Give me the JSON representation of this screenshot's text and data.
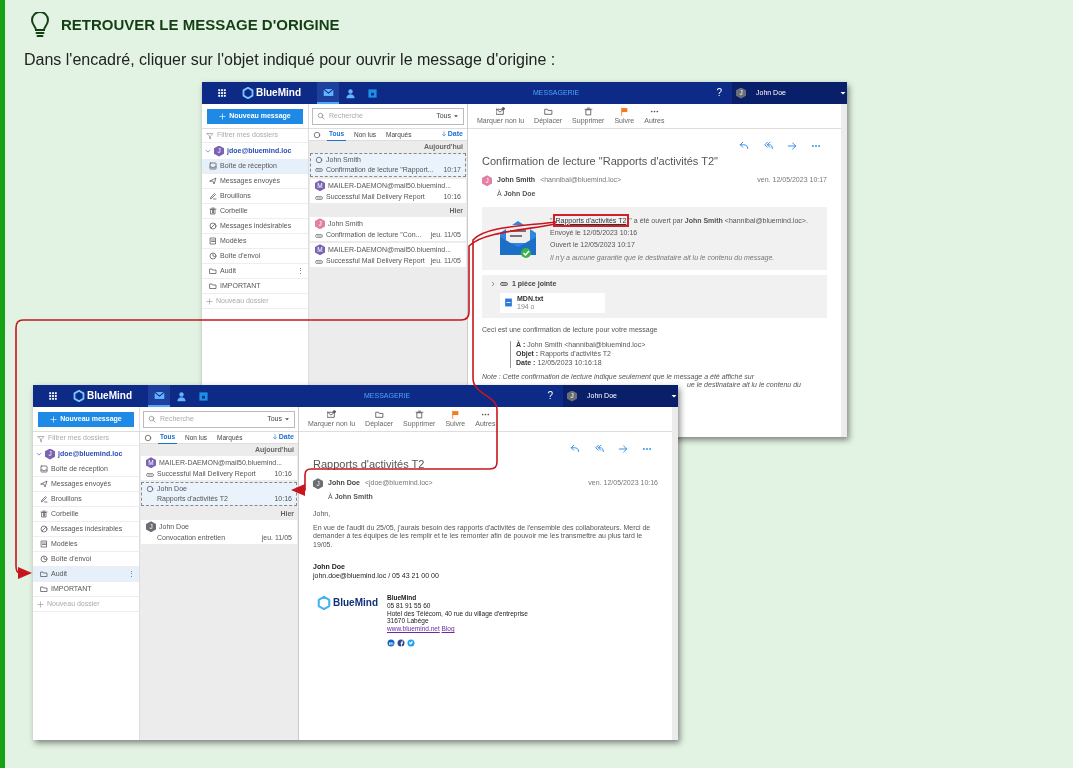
{
  "callout": {
    "title": "RETROUVER LE MESSAGE D'ORIGINE",
    "text": "Dans l'encadré, cliquer sur l'objet indiqué pour ouvrir le message d'origine :"
  },
  "screenshots": [
    {
      "header": {
        "brand": "BlueMind",
        "module": "MESSAGERIE",
        "help": "?",
        "avatar": "J",
        "user": "John Doe"
      },
      "apps": [
        {
          "kind": "mail",
          "selected": true
        },
        {
          "kind": "contacts",
          "selected": false
        },
        {
          "kind": "calendar",
          "selected": false
        }
      ],
      "new_button": "Nouveau message",
      "search": {
        "placeholder": "Recherche",
        "scope": "Tous"
      },
      "toolbar": [
        {
          "kind": "mark-unread",
          "label": "Marquer non lu"
        },
        {
          "kind": "move",
          "label": "Déplacer"
        },
        {
          "kind": "delete",
          "label": "Supprimer"
        },
        {
          "kind": "flag",
          "label": "Suivre"
        },
        {
          "kind": "more",
          "label": "Autres"
        }
      ],
      "folder_filter": {
        "placeholder": "Filtrer mes dossiers"
      },
      "account": {
        "avatar": "J",
        "color": "#7c62b5",
        "email": "jdoe@bluemind.loc"
      },
      "folders": [
        {
          "kind": "inbox",
          "label": "Boîte de réception",
          "selected": true
        },
        {
          "kind": "sent",
          "label": "Messages envoyés",
          "selected": false
        },
        {
          "kind": "drafts",
          "label": "Brouillons",
          "selected": false
        },
        {
          "kind": "trash",
          "label": "Corbeille",
          "selected": false
        },
        {
          "kind": "spam",
          "label": "Messages indésirables",
          "selected": false
        },
        {
          "kind": "templates",
          "label": "Modèles",
          "selected": false
        },
        {
          "kind": "outbox",
          "label": "Boîte d'envoi",
          "selected": false
        },
        {
          "kind": "folder",
          "label": "Audit",
          "selected": false,
          "menu": "⋮"
        },
        {
          "kind": "folder",
          "label": "IMPORTANT",
          "selected": false
        }
      ],
      "new_folder": "Nouveau dossier",
      "list_tabs": [
        {
          "label": "Tous",
          "selected": true
        },
        {
          "label": "Non lus",
          "selected": false
        },
        {
          "label": "Marqués",
          "selected": false
        }
      ],
      "sort": "Date",
      "groups": [
        {
          "label": "Aujourd'hui",
          "messages": [
            {
              "sender": "John Smith",
              "subject": "Confirmation de lecture \"Rapport...",
              "time": "10:17",
              "attachment": true,
              "selected": true
            },
            {
              "avatar": "M",
              "color": "#7c62b5",
              "sender": "MAILER-DAEMON@mail50.bluemind...",
              "subject": "Successful Mail Delivery Report",
              "time": "10:16",
              "attachment": true,
              "selected": false
            }
          ]
        },
        {
          "label": "Hier",
          "messages": [
            {
              "avatar": "J",
              "color": "#e57ea5",
              "sender": "John Smith",
              "subject": "Confirmation de lecture \"Con...",
              "time": "jeu. 11/05",
              "attachment": true,
              "selected": false
            },
            {
              "avatar": "M",
              "color": "#7c62b5",
              "sender": "MAILER-DAEMON@mail50.bluemind...",
              "subject": "Successful Mail Delivery Report",
              "time": "jeu. 11/05",
              "attachment": true,
              "selected": false
            }
          ]
        }
      ],
      "message": {
        "subject": "Confirmation de lecture \"Rapports d'activités T2\"",
        "from": {
          "avatar": "J",
          "color": "#e57ea5",
          "name": "John Smith",
          "email": "<hannibal@bluemind.loc>"
        },
        "date": "ven. 12/05/2023 10:17",
        "to": "À **John Doe**",
        "blocks": [
          {
            "kind": "receipt",
            "before": "\"",
            "link": "Rapports d'activités T2",
            "link_highlighted": true,
            "after": "\" a été ouvert par **John Smith**  <hannibal@bluemind.loc>.",
            "lines": [
              "Envoyé le 12/05/2023 10:16",
              "Ouvert le 12/05/2023 10:17"
            ],
            "disclaimer": "Il n'y a aucune garantie que le destinataire ait lu le contenu du message."
          },
          {
            "kind": "attachments",
            "title": "1 pièce jointe",
            "files": [
              {
                "name": "MDN.txt",
                "size": "194 o"
              }
            ]
          },
          {
            "kind": "text",
            "text": "Ceci est une confirmation de lecture pour votre message"
          },
          {
            "kind": "quote",
            "lines": [
              "**À :** John Smith <hannibal@bluemind.loc>",
              "**Objet :** Rapports d'activités T2",
              "**Date :** 12/05/2023 10:16:18"
            ]
          },
          {
            "kind": "note",
            "lines": [
              "Note : Cette confirmation de lecture indique seulement que le message a été affiché sur",
              "ue le destinataire ait lu le contenu du"
            ]
          }
        ]
      }
    },
    {
      "header": {
        "brand": "BlueMind",
        "module": "MESSAGERIE",
        "help": "?",
        "avatar": "J",
        "user": "John Doe"
      },
      "apps": [
        {
          "kind": "mail",
          "selected": true
        },
        {
          "kind": "contacts",
          "selected": false
        },
        {
          "kind": "calendar",
          "selected": false
        }
      ],
      "new_button": "Nouveau message",
      "search": {
        "placeholder": "Recherche",
        "scope": "Tous"
      },
      "toolbar": [
        {
          "kind": "mark-unread",
          "label": "Marquer non lu"
        },
        {
          "kind": "move",
          "label": "Déplacer"
        },
        {
          "kind": "delete",
          "label": "Supprimer"
        },
        {
          "kind": "flag",
          "label": "Suivre"
        },
        {
          "kind": "more",
          "label": "Autres"
        }
      ],
      "folder_filter": {
        "placeholder": "Filtrer mes dossiers"
      },
      "account": {
        "avatar": "J",
        "color": "#7c62b5",
        "email": "jdoe@bluemind.loc"
      },
      "folders": [
        {
          "kind": "inbox",
          "label": "Boîte de réception",
          "selected": false
        },
        {
          "kind": "sent",
          "label": "Messages envoyés",
          "selected": false
        },
        {
          "kind": "drafts",
          "label": "Brouillons",
          "selected": false
        },
        {
          "kind": "trash",
          "label": "Corbeille",
          "selected": false
        },
        {
          "kind": "spam",
          "label": "Messages indésirables",
          "selected": false
        },
        {
          "kind": "templates",
          "label": "Modèles",
          "selected": false
        },
        {
          "kind": "outbox",
          "label": "Boîte d'envoi",
          "selected": false
        },
        {
          "kind": "folder",
          "label": "Audit",
          "selected": true,
          "menu": "⋮"
        },
        {
          "kind": "folder",
          "label": "IMPORTANT",
          "selected": false
        }
      ],
      "new_folder": "Nouveau dossier",
      "list_tabs": [
        {
          "label": "Tous",
          "selected": true
        },
        {
          "label": "Non lus",
          "selected": false
        },
        {
          "label": "Marqués",
          "selected": false
        }
      ],
      "sort": "Date",
      "groups": [
        {
          "label": "Aujourd'hui",
          "messages": [
            {
              "avatar": "M",
              "color": "#7c62b5",
              "sender": "MAILER-DAEMON@mail50.bluemind...",
              "subject": "Successful Mail Delivery Report",
              "time": "10:16",
              "attachment": true,
              "selected": false
            },
            {
              "sender": "John Doe",
              "subject": "Rapports d'activités T2",
              "time": "10:16",
              "attachment": false,
              "selected": true
            }
          ]
        },
        {
          "label": "Hier",
          "messages": [
            {
              "avatar": "J",
              "color": "#6b6f75",
              "sender": "John Doe",
              "subject": "Convocation entretien",
              "time": "jeu. 11/05",
              "attachment": false,
              "selected": false
            }
          ]
        }
      ],
      "message": {
        "subject": "Rapports d'activités T2",
        "from": {
          "avatar": "J",
          "color": "#6b6f75",
          "name": "John Doe",
          "email": "<jdoe@bluemind.loc>"
        },
        "date": "ven. 12/05/2023 10:16",
        "to": "À **John Smith**",
        "blocks": [
          {
            "kind": "text",
            "text": "John,"
          },
          {
            "kind": "text",
            "text": "En vue de l'audit du 25/05, j'aurais besoin des rapports d'activités de l'ensemble des collaborateurs. Merci de demander à tes équipes de les remplir et te les remonter afin de pouvoir me les transmettre au plus tard le 19/05."
          },
          {
            "kind": "signature",
            "name": "John Doe",
            "contact": "john.doe@bluemind.loc / 05 43 21 00 00",
            "logo": "BlueMind",
            "company": "BlueMind",
            "lines": [
              "05 81 91 55 60",
              "Hotel des Télécom, 40 rue du village d'entreprise",
              "31670 Labège"
            ],
            "links": [
              "www.bluemind.net",
              "Blog"
            ],
            "social": [
              {
                "kind": "linkedin"
              },
              {
                "kind": "facebook"
              },
              {
                "kind": "twitter"
              }
            ]
          }
        ]
      }
    }
  ]
}
